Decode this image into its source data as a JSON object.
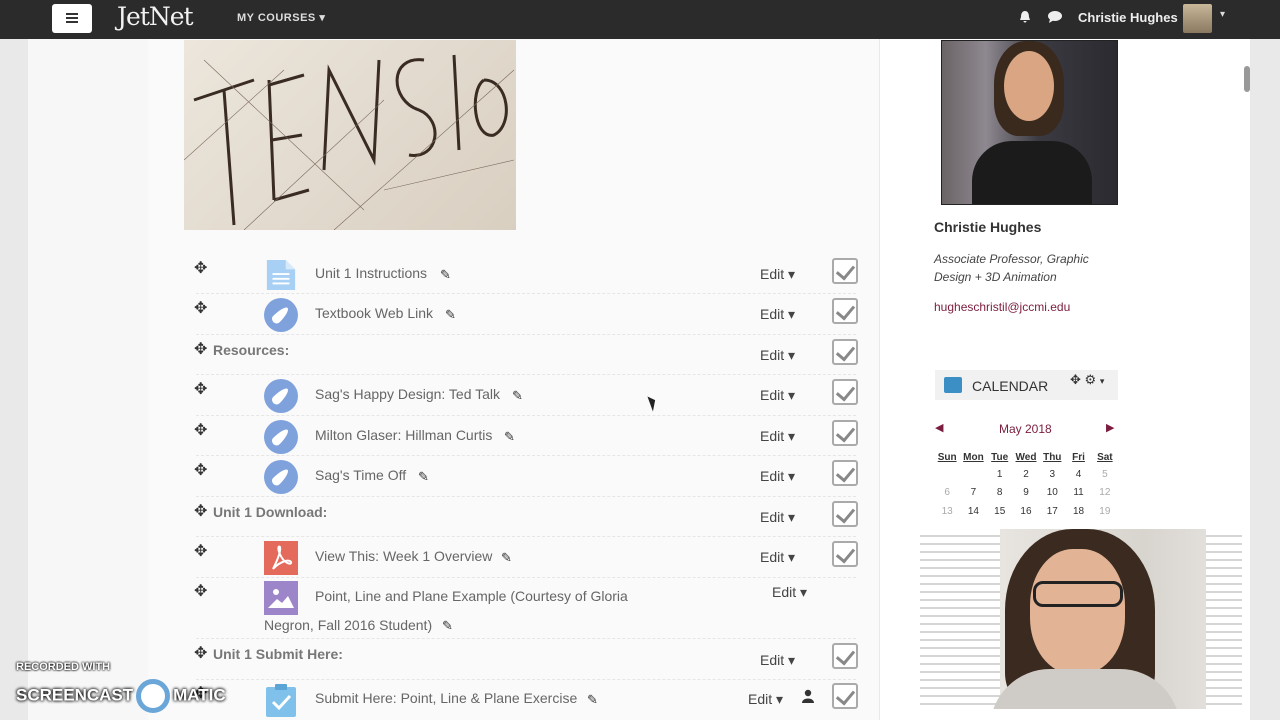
{
  "header": {
    "logo": "JetNet",
    "my_courses": "MY COURSES",
    "user_name": "Christie Hughes"
  },
  "items": [
    {
      "kind": "item",
      "title": "Unit 1 Instructions",
      "icon": "document-icon",
      "edit": "Edit"
    },
    {
      "kind": "item",
      "title": "Textbook Web Link",
      "icon": "compass-icon",
      "edit": "Edit"
    },
    {
      "kind": "section",
      "title": "Resources:",
      "edit": "Edit"
    },
    {
      "kind": "item",
      "title": "Sag's Happy Design: Ted Talk",
      "icon": "compass-icon",
      "edit": "Edit"
    },
    {
      "kind": "item",
      "title": "Milton Glaser: Hillman Curtis",
      "icon": "compass-icon",
      "edit": "Edit"
    },
    {
      "kind": "item",
      "title": "Sag's Time Off",
      "icon": "compass-icon",
      "edit": "Edit"
    },
    {
      "kind": "section",
      "title": "Unit 1 Download:",
      "edit": "Edit"
    },
    {
      "kind": "item",
      "title": "View This: Week 1 Overview",
      "icon": "pdf-icon",
      "edit": "Edit"
    },
    {
      "kind": "item",
      "title": "Point, Line and Plane Example (Courtesy of Gloria",
      "title_line2": "Negron, Fall 2016 Student)",
      "icon": "image-icon",
      "edit": "Edit"
    },
    {
      "kind": "section",
      "title": "Unit 1 Submit Here:",
      "edit": "Edit"
    },
    {
      "kind": "item",
      "title": "Submit Here: Point, Line & Plane Exercise",
      "icon": "assignment-icon",
      "edit": "Edit"
    }
  ],
  "profile": {
    "name": "Christie Hughes",
    "title": "Associate Professor, Graphic Design + 3D Animation",
    "email": "hugheschristil@jccmi.edu"
  },
  "calendar": {
    "label": "CALENDAR",
    "month": "May 2018",
    "days": [
      "Sun",
      "Mon",
      "Tue",
      "Wed",
      "Thu",
      "Fri",
      "Sat"
    ],
    "weeks": [
      [
        "",
        "",
        "1",
        "2",
        "3",
        "4",
        "5"
      ],
      [
        "6",
        "7",
        "8",
        "9",
        "10",
        "11",
        "12"
      ],
      [
        "13",
        "14",
        "15",
        "16",
        "17",
        "18",
        "19"
      ]
    ]
  },
  "watermark": {
    "line1": "RECORDED WITH",
    "line2a": "SCREENCAST",
    "line2b": "MATIC"
  },
  "colors": {
    "topbar": "#2b2b2b",
    "accent": "#7a1d3f",
    "link_icon": "#7fa2dc"
  }
}
